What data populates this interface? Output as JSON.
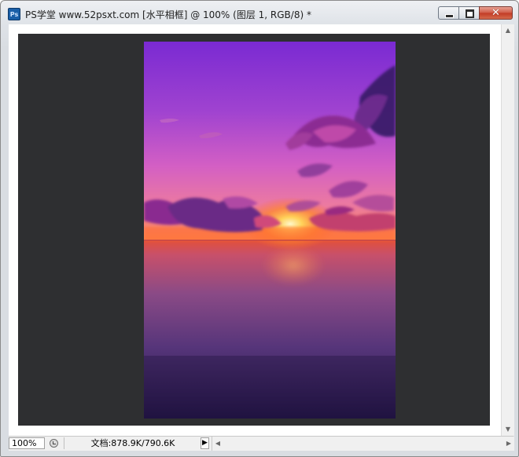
{
  "window": {
    "app_icon_text": "Ps",
    "title": "PS学堂 www.52psxt.com [水平相框] @ 100% (图层 1, RGB/8) *",
    "close_symbol": "✕"
  },
  "statusbar": {
    "zoom": "100%",
    "doc_info": "文档:878.9K/790.6K",
    "menu_arrow": "▶"
  },
  "scrollbars": {
    "up": "▲",
    "down": "▼",
    "left": "◀",
    "right": "▶"
  },
  "icons": {
    "app": "photoshop-app-icon",
    "status": "status-info-icon"
  },
  "image": {
    "subject": "purple sunset over calm sea",
    "colors": {
      "sky_top": "#7a2ad2",
      "sky_mid": "#c050c8",
      "horizon": "#ff7a2a",
      "sun": "#ffe080",
      "water_bottom": "#221445"
    }
  }
}
